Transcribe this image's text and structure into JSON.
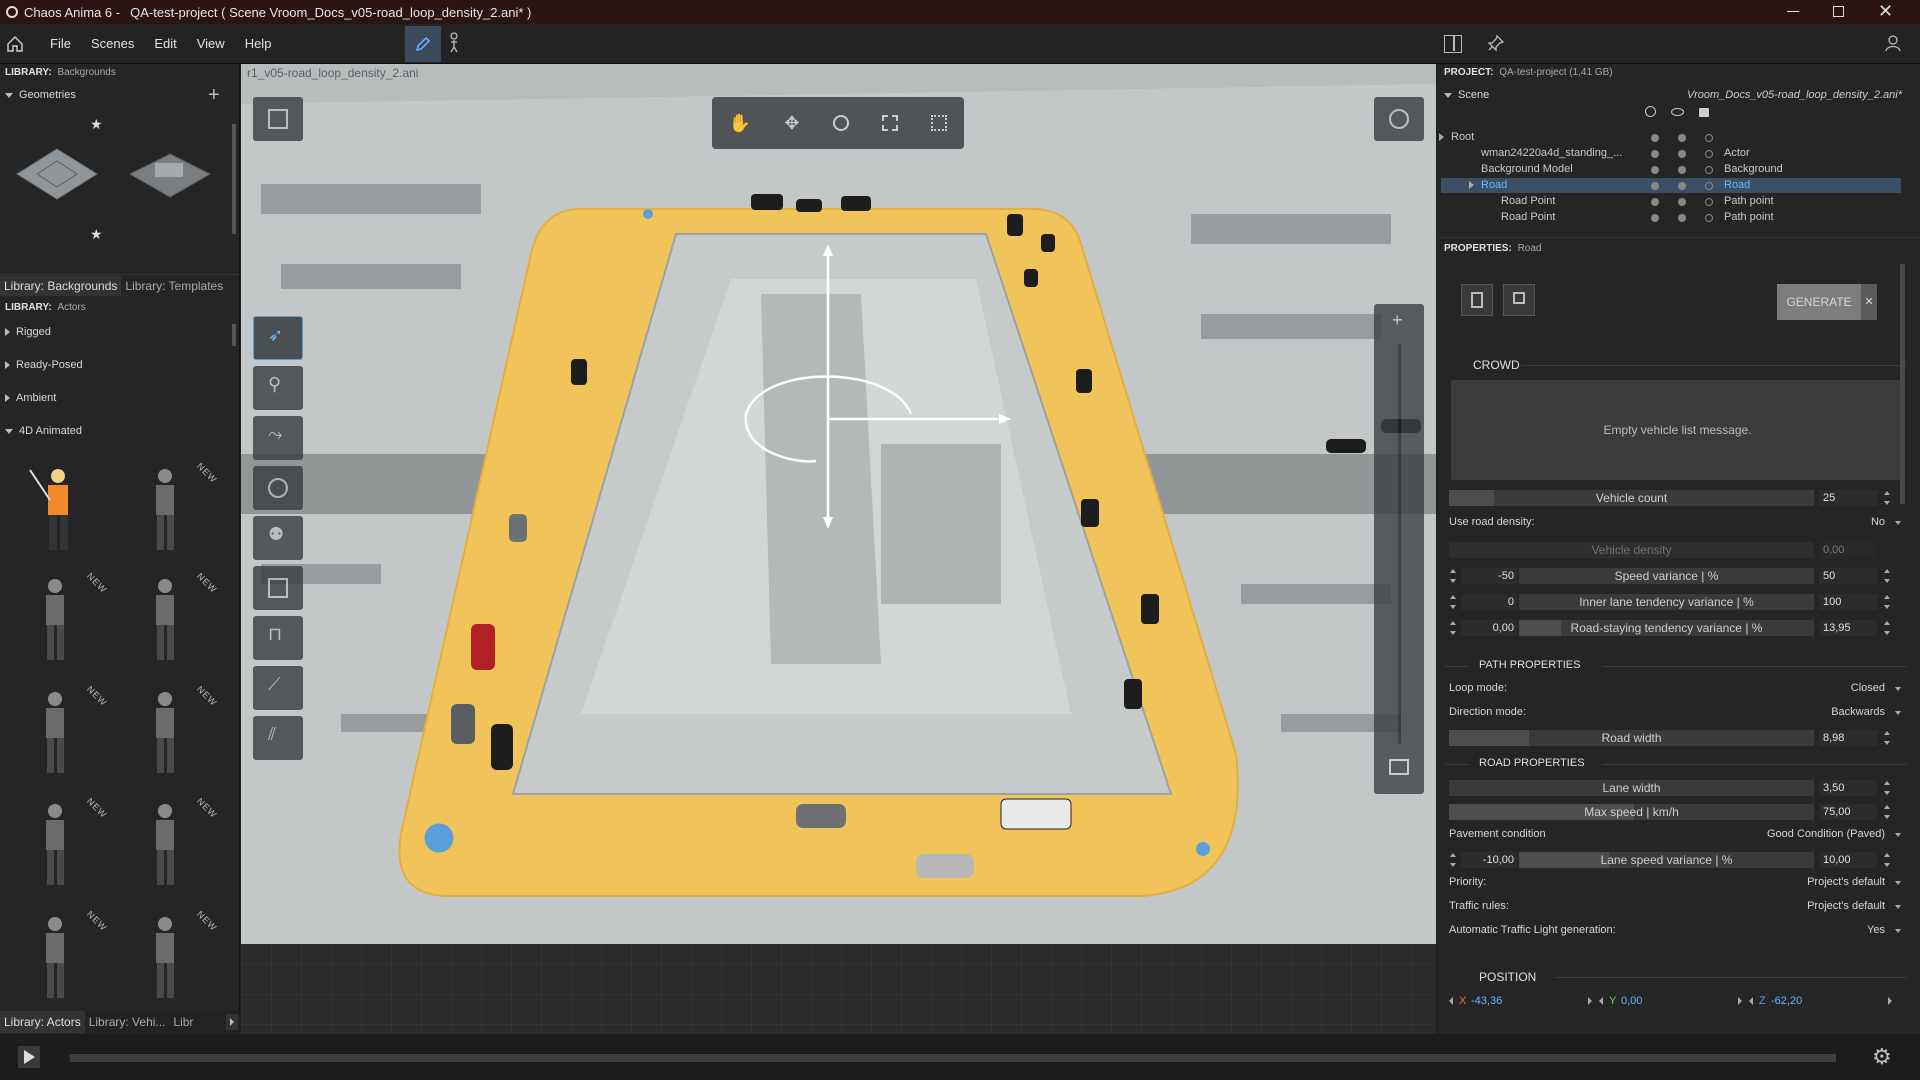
{
  "window": {
    "app_name": "Chaos Anima 6 -",
    "doc_title": "QA-test-project ( Scene Vroom_Docs_v05-road_loop_density_2.ani* )"
  },
  "menu": [
    "File",
    "Scenes",
    "Edit",
    "View",
    "Help"
  ],
  "left": {
    "library_prefix": "LIBRARY:",
    "library_top": "Backgrounds",
    "geometries_label": "Geometries",
    "tabs_top": [
      "Library: Backgrounds",
      "Library: Templates"
    ],
    "library_actors": "Actors",
    "categories": [
      "Rigged",
      "Ready-Posed",
      "Ambient",
      "4D Animated"
    ],
    "new_badge": "NEW",
    "tabs_bottom": [
      "Library: Actors",
      "Library: Vehi...",
      "Libr"
    ]
  },
  "viewport": {
    "path_overlay": "r1_v05-road_loop_density_2.ani"
  },
  "right": {
    "project_prefix": "PROJECT:",
    "project_name": "QA-test-project (1,41 GB)",
    "scene_label": "Scene",
    "scene_file": "Vroom_Docs_v05-road_loop_density_2.ani*",
    "tree": [
      {
        "name": "Root",
        "type": ""
      },
      {
        "name": "wman24220a4d_standing_...",
        "type": "Actor"
      },
      {
        "name": "Background Model",
        "type": "Background"
      },
      {
        "name": "Road",
        "type": "Road"
      },
      {
        "name": "Road Point",
        "type": "Path point"
      },
      {
        "name": "Road Point",
        "type": "Path point"
      }
    ],
    "properties_prefix": "PROPERTIES:",
    "properties_target": "Road",
    "generate_label": "GENERATE",
    "crowd_title": "CROWD",
    "empty_message": "Empty vehicle list message.",
    "vehicle_count_label": "Vehicle count",
    "vehicle_count_value": "25",
    "use_road_density_label": "Use road density:",
    "use_road_density_value": "No",
    "vehicle_density_label": "Vehicle density",
    "vehicle_density_value": "0,00",
    "speed_var": {
      "label": "Speed variance | %",
      "min": "-50",
      "max": "50"
    },
    "inner_lane": {
      "label": "Inner lane tendency variance | %",
      "min": "0",
      "max": "100"
    },
    "road_staying": {
      "label": "Road-staying tendency variance | %",
      "min": "0,00",
      "max": "13,95"
    },
    "path_title": "PATH PROPERTIES",
    "loop_mode_label": "Loop mode:",
    "loop_mode_value": "Closed",
    "direction_label": "Direction mode:",
    "direction_value": "Backwards",
    "road_width_label": "Road width",
    "road_width_value": "8,98",
    "road_title": "ROAD PROPERTIES",
    "lane_width_label": "Lane width",
    "lane_width_value": "3,50",
    "max_speed_label": "Max speed | km/h",
    "max_speed_value": "75,00",
    "pavement_label": "Pavement condition",
    "pavement_value": "Good Condition (Paved)",
    "lane_speed": {
      "label": "Lane speed variance | %",
      "min": "-10,00",
      "max": "10,00"
    },
    "priority_label": "Priority:",
    "priority_value": "Project's default",
    "traffic_label": "Traffic rules:",
    "traffic_value": "Project's default",
    "atl_label": "Automatic Traffic Light generation:",
    "atl_value": "Yes",
    "position_title": "POSITION",
    "pos": {
      "x_label": "X",
      "x": "-43,36",
      "y_label": "Y",
      "y": "0,00",
      "z_label": "Z",
      "z": "-62,20"
    }
  },
  "colors": {
    "road": "#f0c45a",
    "accent": "#5aa0d8",
    "selected_row": "#3a4f66"
  }
}
